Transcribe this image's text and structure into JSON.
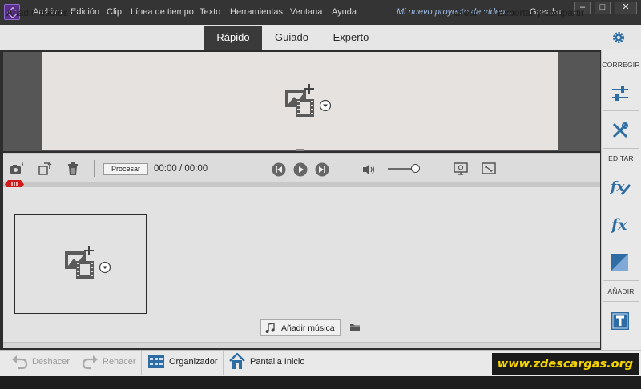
{
  "menu": [
    "Archivo",
    "Edición",
    "Clip",
    "Línea de tiempo",
    "Texto",
    "Herramientas",
    "Ventana",
    "Ayuda"
  ],
  "project_name": "Mi nuevo proyecto de vídeo...",
  "save_label": "Guardar",
  "window_controls": {
    "minimize": "–",
    "maximize": "□",
    "close": "✕"
  },
  "add_media_label": "Añadir medios",
  "modes": {
    "quick": "Rápido",
    "guided": "Guiado",
    "expert": "Experto",
    "active": "Rápido"
  },
  "create_label": "Crear",
  "export_label": "Exportar y compartir",
  "panel": {
    "correct_label": "CORREGIR",
    "edit_label": "EDITAR",
    "add_label": "AÑADIR"
  },
  "render_label": "Procesar",
  "timecode": "00:00 / 00:00",
  "volume_level": 0.85,
  "add_music_label": "Añadir música",
  "bottom": {
    "undo_label": "Deshacer",
    "redo_label": "Rehacer",
    "organizer_label": "Organizador",
    "home_label": "Pantalla Inicio"
  },
  "watermark": "www.zdescargas.org",
  "colors": {
    "accent": "#3a3a3a",
    "playhead": "#d01b1b",
    "icon_blue": "#2e6da4"
  },
  "icons": [
    "camera-icon",
    "crop-icon",
    "trash-icon",
    "skip-back-icon",
    "play-icon",
    "skip-forward-icon",
    "volume-icon",
    "fit-icon",
    "fullscreen-icon",
    "adjust-icon",
    "tools-icon",
    "fx-edit-icon",
    "fx-icon",
    "transition-icon",
    "title-icon",
    "music-icon",
    "folder-icon",
    "undo-icon",
    "redo-icon",
    "organizer-icon",
    "home-icon",
    "gear-icon"
  ]
}
